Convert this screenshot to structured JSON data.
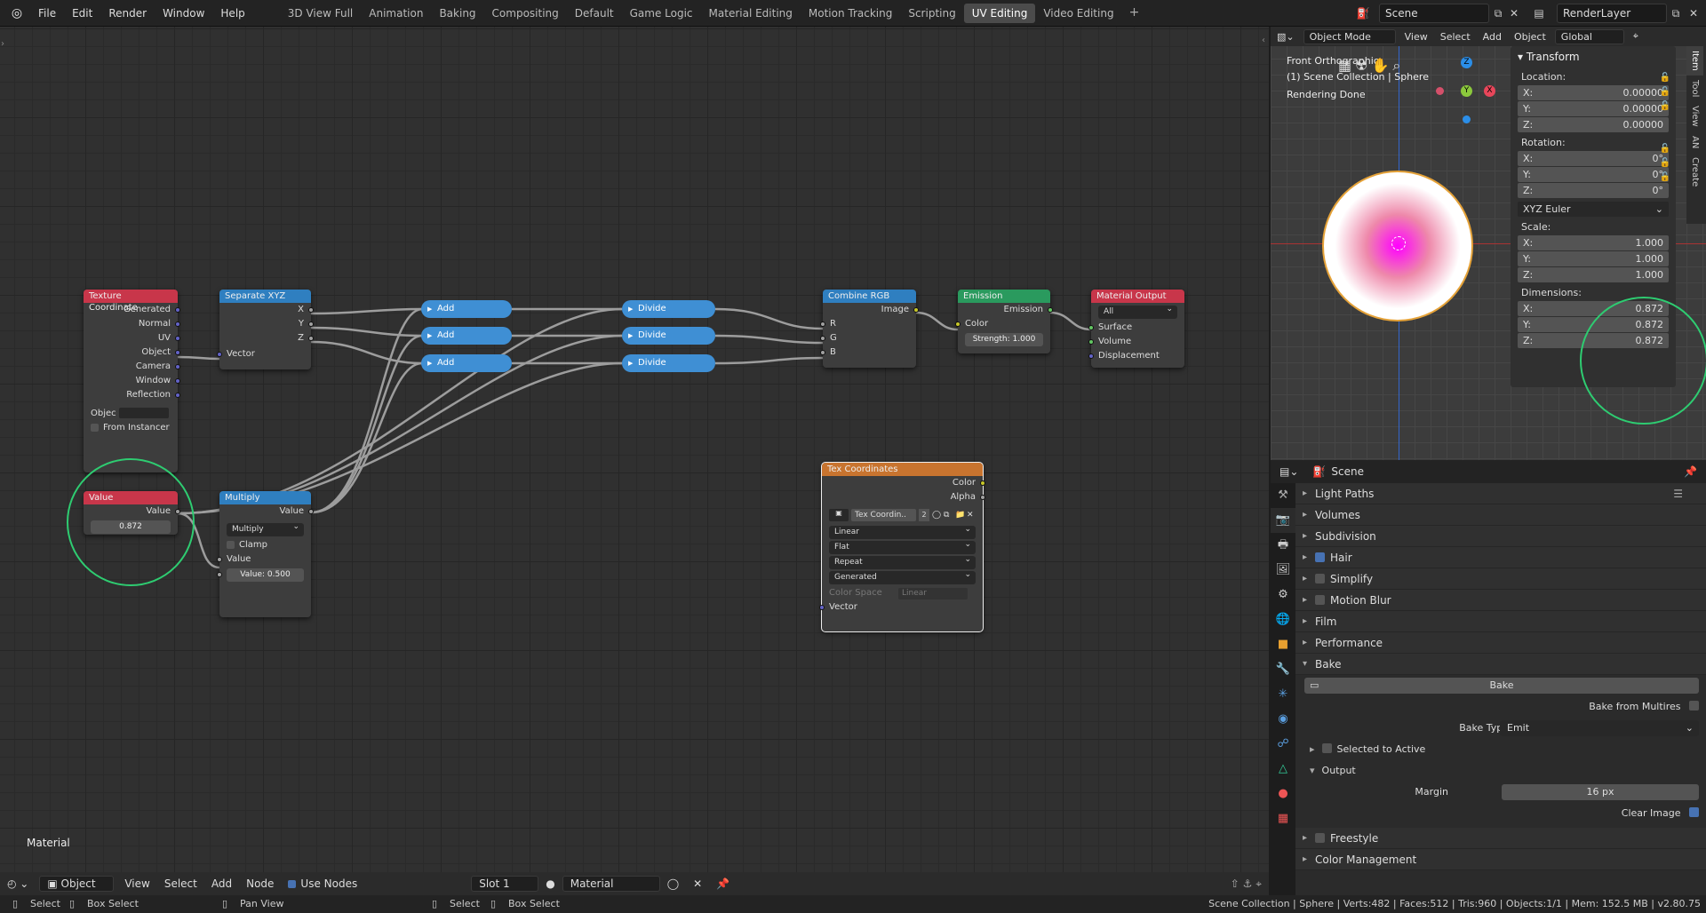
{
  "topbar": {
    "menus": [
      "File",
      "Edit",
      "Render",
      "Window",
      "Help"
    ],
    "workspaces": [
      "3D View Full",
      "Animation",
      "Baking",
      "Compositing",
      "Default",
      "Game Logic",
      "Material Editing",
      "Motion Tracking",
      "Scripting",
      "UV Editing",
      "Video Editing"
    ],
    "active_workspace": "UV Editing",
    "scene": "Scene",
    "view_layer": "RenderLayer"
  },
  "nodes": {
    "tex_coord": {
      "title": "Texture Coordinate",
      "outputs": [
        "Generated",
        "Normal",
        "UV",
        "Object",
        "Camera",
        "Window",
        "Reflection"
      ],
      "object_label": "Objec",
      "from_instancer": "From Instancer"
    },
    "separate": {
      "title": "Separate XYZ",
      "outputs": [
        "X",
        "Y",
        "Z"
      ],
      "input": "Vector"
    },
    "add1": "Add",
    "add2": "Add",
    "add3": "Add",
    "div1": "Divide",
    "div2": "Divide",
    "div3": "Divide",
    "combine": {
      "title": "Combine RGB",
      "output": "Image",
      "inputs": [
        "R",
        "G",
        "B"
      ]
    },
    "emission": {
      "title": "Emission",
      "output": "Emission",
      "color": "Color",
      "strength": "Strength:",
      "strength_val": "1.000"
    },
    "matout": {
      "title": "Material Output",
      "target": "All",
      "inputs": [
        "Surface",
        "Volume",
        "Displacement"
      ]
    },
    "value": {
      "title": "Value",
      "output": "Value",
      "val": "0.872"
    },
    "multiply": {
      "title": "Multiply",
      "output": "Value",
      "op": "Multiply",
      "clamp": "Clamp",
      "input": "Value",
      "field_label": "Value:",
      "field_val": "0.500"
    },
    "texcoords": {
      "title": "Tex Coordinates",
      "outputs": [
        "Color",
        "Alpha"
      ],
      "image": "Tex Coordin..",
      "users": "2",
      "interp": "Linear",
      "proj": "Flat",
      "ext": "Repeat",
      "source": "Generated",
      "cs_label": "Color Space",
      "cs_val": "Linear",
      "input": "Vector"
    }
  },
  "editor_label": "Material",
  "node_header": {
    "editor": "Object",
    "items": [
      "View",
      "Select",
      "Add",
      "Node"
    ],
    "use_nodes": "Use Nodes",
    "slot": "Slot 1",
    "material": "Material"
  },
  "viewport": {
    "mode": "Object Mode",
    "menus": [
      "View",
      "Select",
      "Add",
      "Object"
    ],
    "orientation": "Global",
    "overlay": [
      "Front Orthographic",
      "(1) Scene Collection | Sphere",
      "Rendering Done"
    ],
    "gizmo": {
      "z": "Z",
      "y": "Y",
      "x": "X"
    }
  },
  "npanel": {
    "title": "Transform",
    "location_label": "Location:",
    "location": [
      [
        "X:",
        "0.00000"
      ],
      [
        "Y:",
        "0.00000"
      ],
      [
        "Z:",
        "0.00000"
      ]
    ],
    "rotation_label": "Rotation:",
    "rotation": [
      [
        "X:",
        "0°"
      ],
      [
        "Y:",
        "0°"
      ],
      [
        "Z:",
        "0°"
      ]
    ],
    "rot_mode": "XYZ Euler",
    "scale_label": "Scale:",
    "scale": [
      [
        "X:",
        "1.000"
      ],
      [
        "Y:",
        "1.000"
      ],
      [
        "Z:",
        "1.000"
      ]
    ],
    "dim_label": "Dimensions:",
    "dimensions": [
      [
        "X:",
        "0.872"
      ],
      [
        "Y:",
        "0.872"
      ],
      [
        "Z:",
        "0.872"
      ]
    ],
    "tabs": [
      "Item",
      "Tool",
      "View",
      "AN",
      "Create"
    ]
  },
  "properties": {
    "context": "Scene",
    "sections": [
      "Light Paths",
      "Volumes",
      "Subdivision",
      "Hair",
      "Simplify",
      "Motion Blur",
      "Film",
      "Performance",
      "Bake"
    ],
    "bake_button": "Bake",
    "bake_multires": "Bake from Multires",
    "bake_type_label": "Bake Type",
    "bake_type": "Emit",
    "selected_to_active": "Selected to Active",
    "output": "Output",
    "margin_label": "Margin",
    "margin": "16 px",
    "clear_image": "Clear Image",
    "after": [
      "Freestyle",
      "Color Management"
    ]
  },
  "status": {
    "left": [
      "Select",
      "Box Select",
      "Pan View",
      "Select",
      "Box Select"
    ],
    "right": "Scene Collection | Sphere | Verts:482 | Faces:512 | Tris:960 | Objects:1/1 | Mem: 152.5 MB | v2.80.75"
  }
}
